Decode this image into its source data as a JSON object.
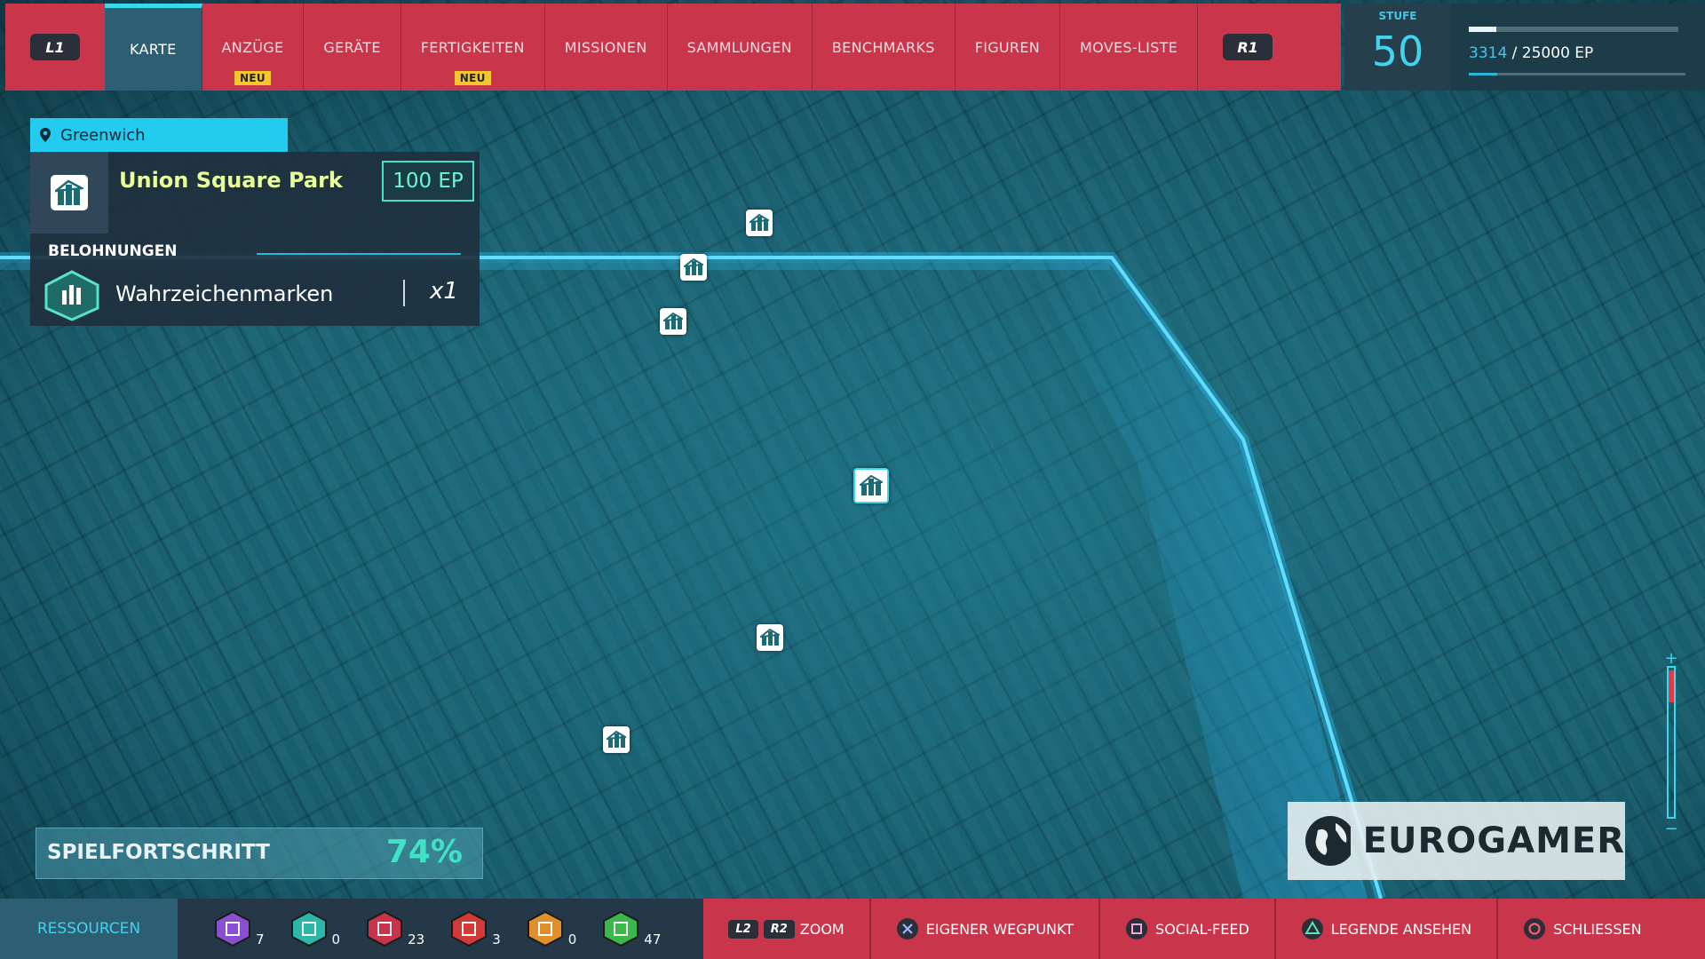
{
  "top_nav": {
    "left_bumper": "L1",
    "right_bumper": "R1",
    "tabs": [
      {
        "label": "KARTE",
        "active": true,
        "badge": ""
      },
      {
        "label": "ANZÜGE",
        "active": false,
        "badge": "NEU"
      },
      {
        "label": "GERÄTE",
        "active": false,
        "badge": ""
      },
      {
        "label": "FERTIGKEITEN",
        "active": false,
        "badge": "NEU"
      },
      {
        "label": "MISSIONEN",
        "active": false,
        "badge": ""
      },
      {
        "label": "SAMMLUNGEN",
        "active": false,
        "badge": ""
      },
      {
        "label": "BENCHMARKS",
        "active": false,
        "badge": ""
      },
      {
        "label": "FIGUREN",
        "active": false,
        "badge": ""
      },
      {
        "label": "MOVES-LISTE",
        "active": false,
        "badge": ""
      }
    ]
  },
  "level": {
    "label": "STUFE",
    "value": "50",
    "xp_current": "3314",
    "xp_separator": " / 25000 EP",
    "xp_fraction": 0.13
  },
  "location": {
    "district": "Greenwich",
    "name": "Union Square Park",
    "xp_reward": "100 EP",
    "rewards_heading": "BELOHNUNGEN",
    "reward_name": "Wahrzeichenmarken",
    "reward_count": "x1"
  },
  "progress": {
    "label": "SPIELFORTSCHRITT",
    "value": "74%"
  },
  "watermark": {
    "text": "EUROGAMER"
  },
  "resources": {
    "label": "RESSOURCEN",
    "items": [
      {
        "icon": "research-token-icon",
        "count": "7",
        "color": "#8a4fd0"
      },
      {
        "icon": "landmark-token-icon",
        "count": "0",
        "color": "#2ab7a8"
      },
      {
        "icon": "backpack-token-icon",
        "count": "23",
        "color": "#c8324a"
      },
      {
        "icon": "crime-token-icon",
        "count": "3",
        "color": "#d23a3a"
      },
      {
        "icon": "challenge-token-icon",
        "count": "0",
        "color": "#e0902a"
      },
      {
        "icon": "base-token-icon",
        "count": "47",
        "color": "#3ab84a"
      }
    ]
  },
  "actions": {
    "zoom_keys": [
      "L2",
      "R2"
    ],
    "zoom": "ZOOM",
    "waypoint": "EIGENER WEGPUNKT",
    "social": "SOCIAL-FEED",
    "legend": "LEGENDE ANSEHEN",
    "close": "SCHLIESSEN"
  },
  "colors": {
    "accent": "#3ad7ef",
    "bar_red": "#c9354b",
    "xp_green": "#6af7d3"
  }
}
